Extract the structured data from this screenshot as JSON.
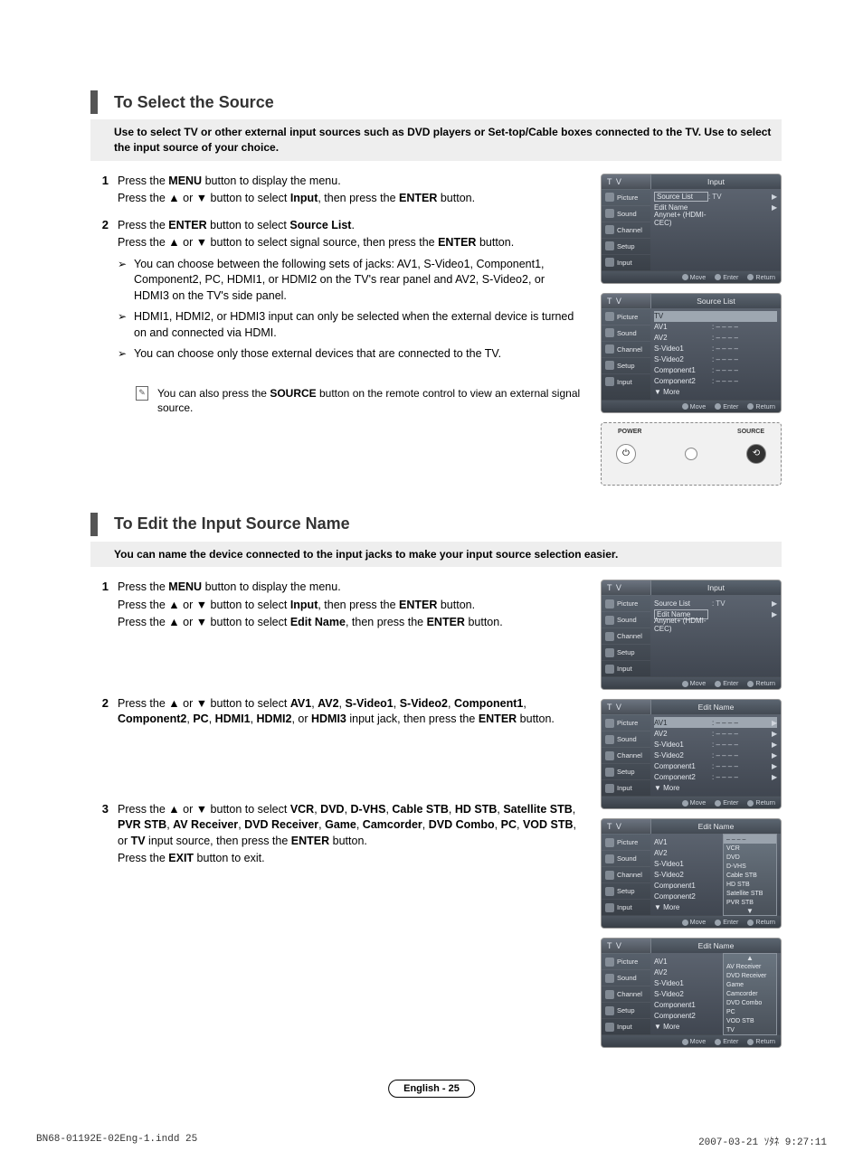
{
  "section1": {
    "title": "To Select the Source",
    "intro": "Use to select TV or other external input sources such as DVD players or Set-top/Cable boxes connected to the TV. Use to select the input source of your choice.",
    "steps": [
      {
        "num": "1",
        "lines": [
          "Press the <b>MENU</b> button to display the menu.",
          "Press the ▲ or ▼ button to select <b>Input</b>, then press the <b>ENTER</b> button."
        ]
      },
      {
        "num": "2",
        "lines": [
          "Press the <b>ENTER</b> button to select <b>Source List</b>.",
          "Press the ▲ or ▼ button to select signal source, then press the <b>ENTER</b> button."
        ],
        "arrows": [
          "You can choose between the following sets of jacks: AV1, S-Video1, Component1, Component2, PC, HDMI1, or HDMI2 on the TV's rear panel and AV2, S-Video2, or HDMI3 on the TV's side panel.",
          "HDMI1, HDMI2, or HDMI3 input can only be selected when the external device is turned on and connected via HDMI.",
          "You can choose only those external devices that are connected to the TV."
        ]
      }
    ],
    "note": "You can also press the <b>SOURCE</b> button on the remote control to view an external signal source."
  },
  "section2": {
    "title": "To Edit the Input Source Name",
    "intro": "You can name the device connected to the input jacks to make your input source selection easier.",
    "steps": [
      {
        "num": "1",
        "lines": [
          "Press the <b>MENU</b> button to display the menu.",
          "Press the ▲ or ▼ button to select <b>Input</b>, then press the <b>ENTER</b> button.",
          "Press the ▲ or ▼ button to select <b>Edit Name</b>, then press the <b>ENTER</b> button."
        ]
      },
      {
        "num": "2",
        "lines": [
          "Press the ▲ or ▼ button to select <b>AV1</b>, <b>AV2</b>, <b>S-Video1</b>, <b>S-Video2</b>, <b>Component1</b>, <b>Component2</b>, <b>PC</b>, <b>HDMI1</b>, <b>HDMI2</b>, or <b>HDMI3</b> input jack, then press the <b>ENTER</b> button."
        ]
      },
      {
        "num": "3",
        "lines": [
          "Press the ▲ or ▼ button to select <b>VCR</b>, <b>DVD</b>, <b>D-VHS</b>, <b>Cable STB</b>, <b>HD STB</b>, <b>Satellite STB</b>, <b>PVR STB</b>, <b>AV Receiver</b>, <b>DVD Receiver</b>, <b>Game</b>, <b>Camcorder</b>, <b>DVD Combo</b>, <b>PC</b>, <b>VOD STB</b>, or <b>TV</b> input source, then press the <b>ENTER</b> button.",
          "Press the <b>EXIT</b> button to exit."
        ]
      }
    ]
  },
  "osd": {
    "tv_label": "T V",
    "sidebar": [
      "Picture",
      "Sound",
      "Channel",
      "Setup",
      "Input"
    ],
    "footer": {
      "move": "Move",
      "enter": "Enter",
      "return": "Return"
    },
    "panel1": {
      "header": "Input",
      "rows": [
        {
          "label": "Source List",
          "value": ": TV",
          "boxed": true,
          "arrow": true
        },
        {
          "label": "Edit Name",
          "value": "",
          "arrow": true
        },
        {
          "label": "Anynet+ (HDMI-CEC)",
          "value": ""
        }
      ]
    },
    "panel2": {
      "header": "Source List",
      "rows": [
        {
          "label": "TV",
          "value": "",
          "highlight": true
        },
        {
          "label": "AV1",
          "value": ": – – – –"
        },
        {
          "label": "AV2",
          "value": ": – – – –"
        },
        {
          "label": "S-Video1",
          "value": ": – – – –"
        },
        {
          "label": "S-Video2",
          "value": ": – – – –"
        },
        {
          "label": "Component1",
          "value": ": – – – –"
        },
        {
          "label": "Component2",
          "value": ": – – – –"
        },
        {
          "label": "▼ More",
          "value": ""
        }
      ]
    },
    "panel3": {
      "header": "Input",
      "rows": [
        {
          "label": "Source List",
          "value": ":   TV",
          "arrow": true
        },
        {
          "label": "Edit Name",
          "value": "",
          "boxed": true,
          "arrow": true
        },
        {
          "label": "Anynet+ (HDMI-CEC)",
          "value": ""
        }
      ]
    },
    "panel4": {
      "header": "Edit Name",
      "rows": [
        {
          "label": "AV1",
          "value": ": – – – –",
          "highlight": true,
          "arrow": true
        },
        {
          "label": "AV2",
          "value": ": – – – –",
          "arrow": true
        },
        {
          "label": "S-Video1",
          "value": ": – – – –",
          "arrow": true
        },
        {
          "label": "S-Video2",
          "value": ": – – – –",
          "arrow": true
        },
        {
          "label": "Component1",
          "value": ": – – – –",
          "arrow": true
        },
        {
          "label": "Component2",
          "value": ": – – – –",
          "arrow": true
        },
        {
          "label": "▼ More",
          "value": ""
        }
      ]
    },
    "panel5": {
      "header": "Edit Name",
      "rows": [
        {
          "label": "AV1",
          "value": ""
        },
        {
          "label": "AV2",
          "value": ""
        },
        {
          "label": "S-Video1",
          "value": ""
        },
        {
          "label": "S-Video2",
          "value": ""
        },
        {
          "label": "Component1",
          "value": ""
        },
        {
          "label": "Component2",
          "value": ""
        },
        {
          "label": "▼ More",
          "value": ""
        }
      ],
      "dropdown": {
        "selected": "– – – –",
        "items": [
          "VCR",
          "DVD",
          "D-VHS",
          "Cable STB",
          "HD STB",
          "Satellite STB",
          "PVR STB"
        ],
        "arrow_down": true
      }
    },
    "panel6": {
      "header": "Edit Name",
      "rows": [
        {
          "label": "AV1",
          "value": ""
        },
        {
          "label": "AV2",
          "value": ""
        },
        {
          "label": "S-Video1",
          "value": ""
        },
        {
          "label": "S-Video2",
          "value": ""
        },
        {
          "label": "Component1",
          "value": ""
        },
        {
          "label": "Component2",
          "value": ""
        },
        {
          "label": "▼ More",
          "value": ""
        }
      ],
      "dropdown": {
        "items_top": [
          "AV Receiver"
        ],
        "items": [
          "DVD Receiver",
          "Game",
          "Camcorder",
          "DVD Combo",
          "PC",
          "VOD STB",
          "TV"
        ],
        "arrow_up": true
      }
    }
  },
  "remote": {
    "power": "POWER",
    "source": "SOURCE"
  },
  "page_footer": "English - 25",
  "doc_meta": {
    "left": "BN68-01192E-02Eng-1.indd   25",
    "right": "2007-03-21   ｿﾀﾈ 9:27:11"
  }
}
